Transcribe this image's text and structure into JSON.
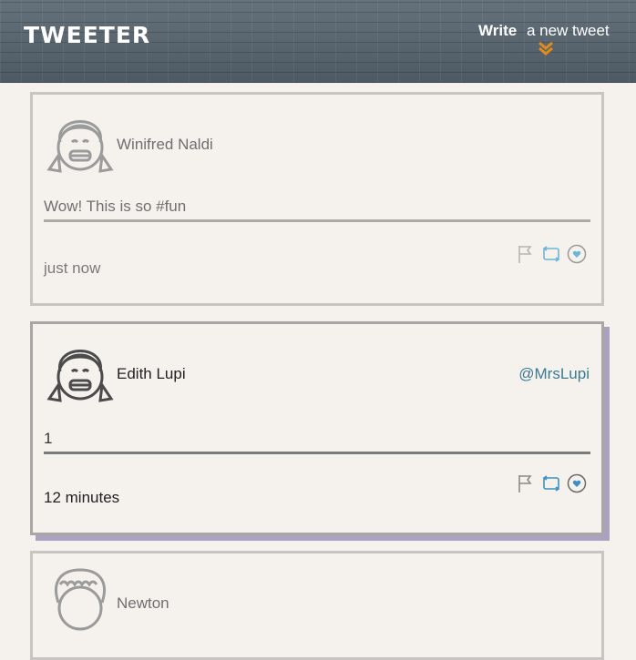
{
  "header": {
    "logo": "TWEETER",
    "compose_write": "Write",
    "compose_rest": "a new tweet",
    "accent": "#e08a1e"
  },
  "tweets": [
    {
      "name": "Winifred Naldi",
      "handle": "",
      "text": "Wow! This is so #fun",
      "time": "just now"
    },
    {
      "name": "Edith Lupi",
      "handle": "@MrsLupi",
      "text": "1",
      "time": "12 minutes"
    },
    {
      "name": "Newton",
      "handle": "",
      "text": "",
      "time": ""
    }
  ],
  "icons": {
    "flag": "flag-icon",
    "retweet": "retweet-icon",
    "like": "heart-icon",
    "avatar": "avatar-icon",
    "chevron": "double-chevron-down-icon"
  },
  "colors": {
    "background": "#f5f2ee",
    "handle": "#3c7a91",
    "icon_blue": "#6fb3d6",
    "active_shadow": "#a9a3bf"
  }
}
